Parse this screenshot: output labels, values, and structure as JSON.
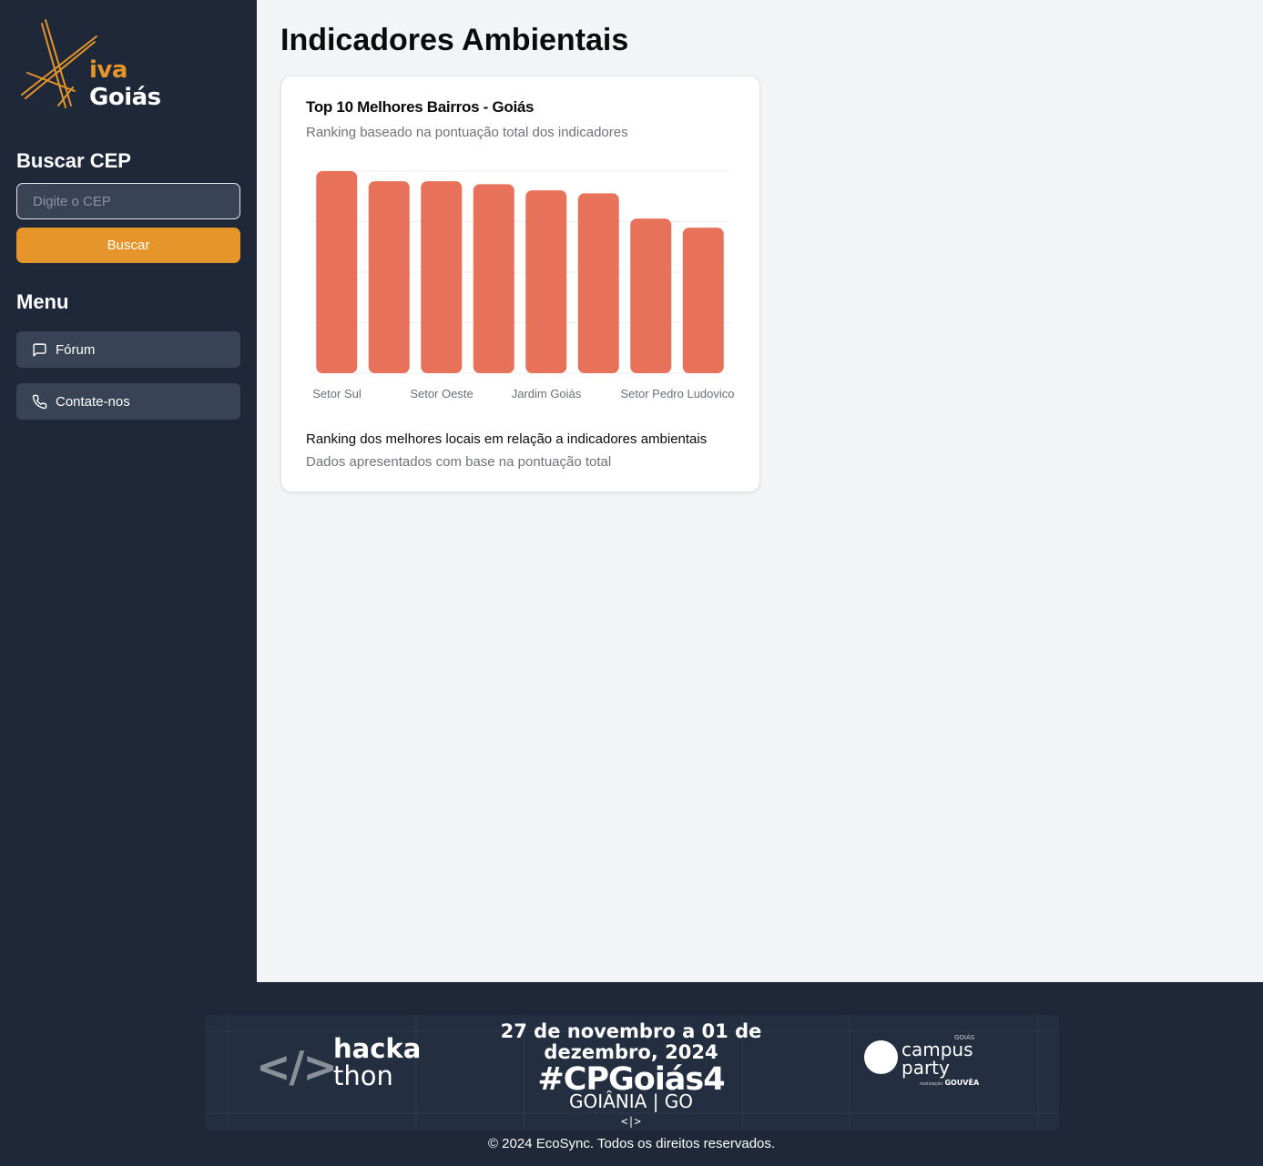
{
  "brand": {
    "logo_text_accent": "iva",
    "logo_text_main": "Goiás",
    "accent_color": "#e5952a",
    "sidebar_bg": "#1f2838"
  },
  "sidebar": {
    "search_heading": "Buscar CEP",
    "cep_placeholder": "Digite o CEP",
    "cep_value": "",
    "search_button": "Buscar",
    "menu_heading": "Menu",
    "menu_items": [
      {
        "label": "Fórum",
        "icon": "message-square-icon"
      },
      {
        "label": "Contate-nos",
        "icon": "phone-icon"
      }
    ]
  },
  "main": {
    "page_title": "Indicadores Ambientais",
    "card": {
      "title": "Top 10 Melhores Bairros - Goiás",
      "subtitle": "Ranking baseado na pontuação total dos indicadores",
      "footer_text": "Ranking dos melhores locais em relação a indicadores ambientais",
      "footer_subtext": "Dados apresentados com base na pontuação total"
    }
  },
  "chart_data": {
    "type": "bar",
    "title": "Top 10 Melhores Bairros - Goiás",
    "subtitle": "Ranking baseado na pontuação total dos indicadores",
    "xlabel": "",
    "ylabel": "",
    "bar_color": "#e8715a",
    "grid": true,
    "visible_tick_labels": [
      "Setor Sul",
      "Setor Oeste",
      "Jardim Goiás",
      "Setor Pedro Ludovico"
    ],
    "values": [
      100,
      95,
      95,
      93.5,
      90.5,
      89,
      76.5,
      72
    ],
    "ylim": [
      0,
      100
    ]
  },
  "footer": {
    "banner": {
      "hack_icon": "</>",
      "hack_line1": "hacka",
      "hack_line2": "thon",
      "date_line1": "27 de novembro a 01 de",
      "date_line2": "dezembro, 2024",
      "hashtag": "#CPGoiás4",
      "city": "GOIÂNIA | GO",
      "code_mark": "<|>",
      "cp_state": "GOIÁS",
      "cp_line1": "campus",
      "cp_line2": "party",
      "cp_sponsor_prefix": "realização",
      "cp_sponsor": "GOUVÊA"
    },
    "copyright": "© 2024 EcoSync. Todos os direitos reservados."
  }
}
